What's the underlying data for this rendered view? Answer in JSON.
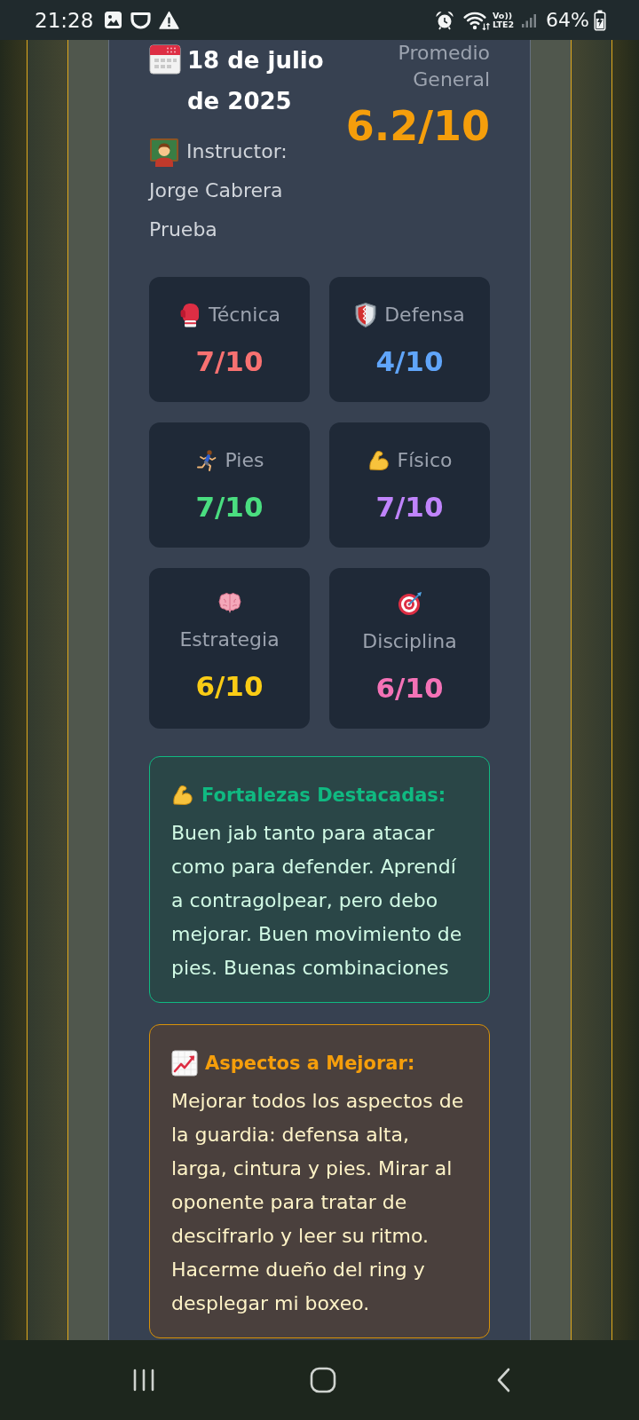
{
  "status_bar": {
    "time": "21:28",
    "network": [
      "Vo))",
      "LTE2"
    ],
    "battery": "64%"
  },
  "evaluation": {
    "date": "18 de julio de 2025",
    "instructor_label": "Instructor:",
    "instructor": "Jorge Cabrera Prueba",
    "average_label": "Promedio General",
    "average": "6.2/10"
  },
  "stats": [
    {
      "label": "Técnica",
      "value": "7/10",
      "color": "#f87171"
    },
    {
      "label": "Defensa",
      "value": "4/10",
      "color": "#60a5fa"
    },
    {
      "label": "Pies",
      "value": "7/10",
      "color": "#4ade80"
    },
    {
      "label": "Físico",
      "value": "7/10",
      "color": "#c084fc"
    },
    {
      "label": "Estrategia",
      "value": "6/10",
      "color": "#facc15"
    },
    {
      "label": "Disciplina",
      "value": "6/10",
      "color": "#f472b6"
    }
  ],
  "notes": [
    {
      "kind": "strengths",
      "title": "Fortalezas Destacadas:",
      "text": "Buen jab tanto para atacar como para defender. Aprendí a contragolpear, pero debo mejorar. Buen movimiento de pies. Buenas combinaciones"
    },
    {
      "kind": "improvements",
      "title": "Aspectos a Mejorar:",
      "text": "Mejorar todos los aspectos de la guardia: defensa alta, larga, cintura y pies. Mirar al oponente para tratar de descifrarlo y leer su ritmo. Hacerme dueño del ring y desplegar mi boxeo."
    }
  ]
}
